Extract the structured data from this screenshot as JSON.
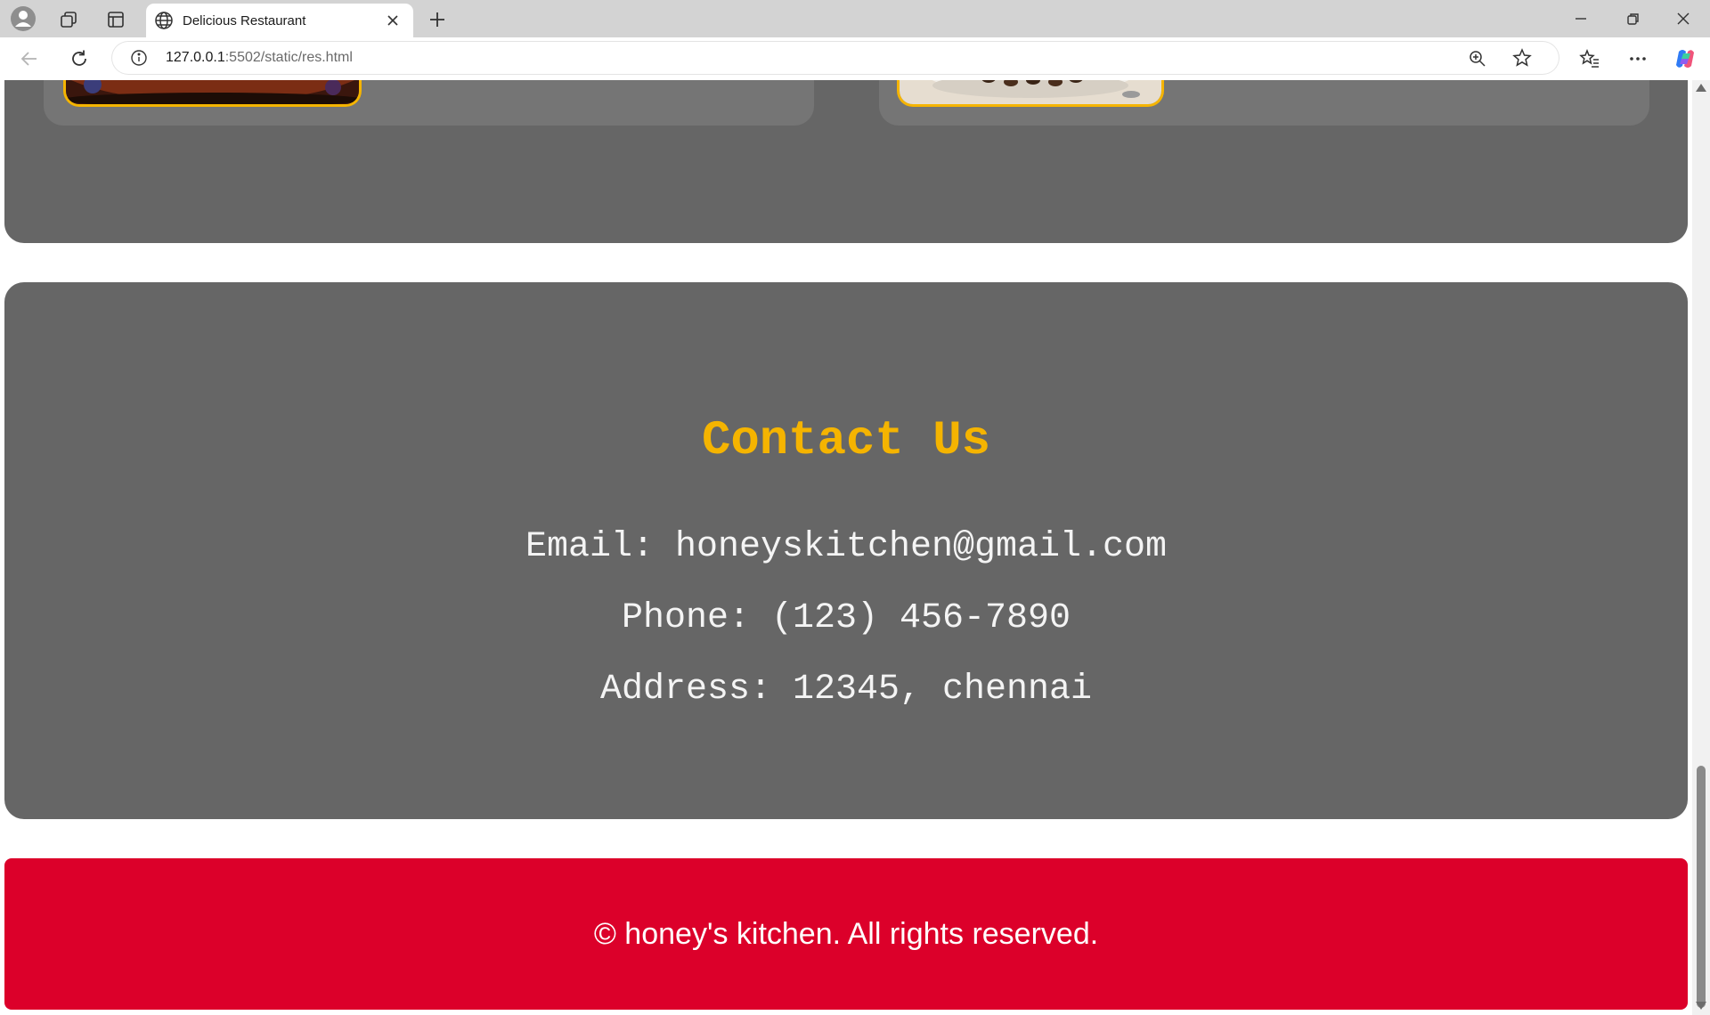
{
  "browser": {
    "tab_title": "Delicious Restaurant",
    "url_host": "127.0.0.1",
    "url_rest": ":5502/static/res.html"
  },
  "contact": {
    "heading": "Contact Us",
    "email": "Email: honeyskitchen@gmail.com",
    "phone": "Phone: (123) 456-7890",
    "address": "Address: 12345, chennai"
  },
  "footer": {
    "text": "© honey's kitchen. All rights reserved."
  },
  "colors": {
    "section_bg": "#666666",
    "card_bg": "#757575",
    "accent_yellow": "#f5b400",
    "footer_red": "#dc002a"
  }
}
